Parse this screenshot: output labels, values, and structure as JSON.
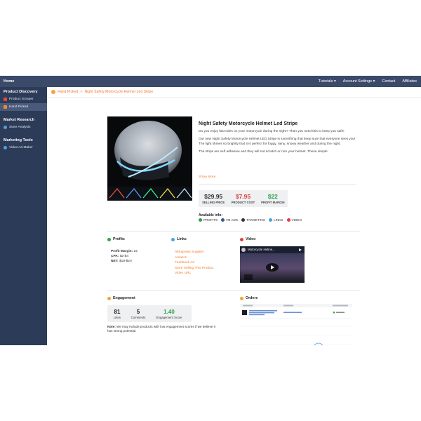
{
  "topbar": {
    "home": "Home",
    "nav": [
      "Tutorials ▾",
      "Account Settings ▾",
      "Contact",
      "Affiliates"
    ]
  },
  "sidebar": {
    "sections": [
      {
        "title": "Product Discovery",
        "items": [
          {
            "label": "Product Scraper",
            "color": "#e04a3a"
          },
          {
            "label": "Hand Picked",
            "color": "#f28a2b",
            "active": true
          }
        ]
      },
      {
        "title": "Market Research",
        "items": [
          {
            "label": "Store Analysis",
            "color": "#4aa3df"
          }
        ]
      },
      {
        "title": "Marketing Tools",
        "items": [
          {
            "label": "Video Ad Maker",
            "color": "#4aa3df"
          }
        ]
      }
    ]
  },
  "breadcrumb": {
    "root": "Hand Picked",
    "sep": ">",
    "current": "Night Safety Motorcycle Helmet Led Stripe"
  },
  "product": {
    "title": "Night Safety Motorcycle Helmet Led Stripe",
    "desc1": "Do you enjoy fast rides on your motorcycle during the night? Than you need this to keep you safe!",
    "desc2": "Our new Night Safety Motorcycle Helmet LED Stripe is something that keep sure that everyone sees you! The light shines so brightly that it is perfect for foggy, rainy, snowy weather and during the night.",
    "desc3": "The strips are self adhesive and they will not scratch or ruin your helmet. These simple",
    "show_more": "Show More"
  },
  "pricing": {
    "selling": {
      "value": "$29.95",
      "label": "SELLING PRICE",
      "color": "#333333"
    },
    "cost": {
      "value": "$7.95",
      "label": "PRODUCT COST",
      "color": "#e0403a"
    },
    "margin": {
      "value": "$22",
      "label": "PROFIT MARGIN",
      "color": "#35a04a"
    }
  },
  "available": {
    "title": "Available info:",
    "items": [
      {
        "label": "PROFITS",
        "color": "#35a04a"
      },
      {
        "label": "FB ADS",
        "color": "#3b5998"
      },
      {
        "label": "TARGETING",
        "color": "#333333"
      },
      {
        "label": "LINKS",
        "color": "#4aa3df"
      },
      {
        "label": "VIDEO",
        "color": "#e0403a"
      }
    ]
  },
  "profits": {
    "title": "Profits",
    "margin_label": "Profit Margin:",
    "margin_value": "22",
    "cpa_label": "CPA:",
    "cpa_value": "$2-$4",
    "net_label": "NET:",
    "net_value": "$18-$20"
  },
  "links": {
    "title": "Links",
    "items": [
      "AliExpress Supplier",
      "Amazon",
      "Facebook Ad",
      "Store Selling This Product",
      "Video URL"
    ]
  },
  "video": {
    "title": "Video",
    "caption": "Motorcycle Helme..."
  },
  "engagement": {
    "title": "Engagement",
    "likes": {
      "value": "81",
      "label": "Likes"
    },
    "comments": {
      "value": "5",
      "label": "Comments"
    },
    "score": {
      "value": "1.40",
      "label": "Engagement Score"
    },
    "note_label": "Note:",
    "note": "We may include products with low engagement scores if we believe it has strong potential."
  },
  "orders": {
    "title": "Orders"
  }
}
